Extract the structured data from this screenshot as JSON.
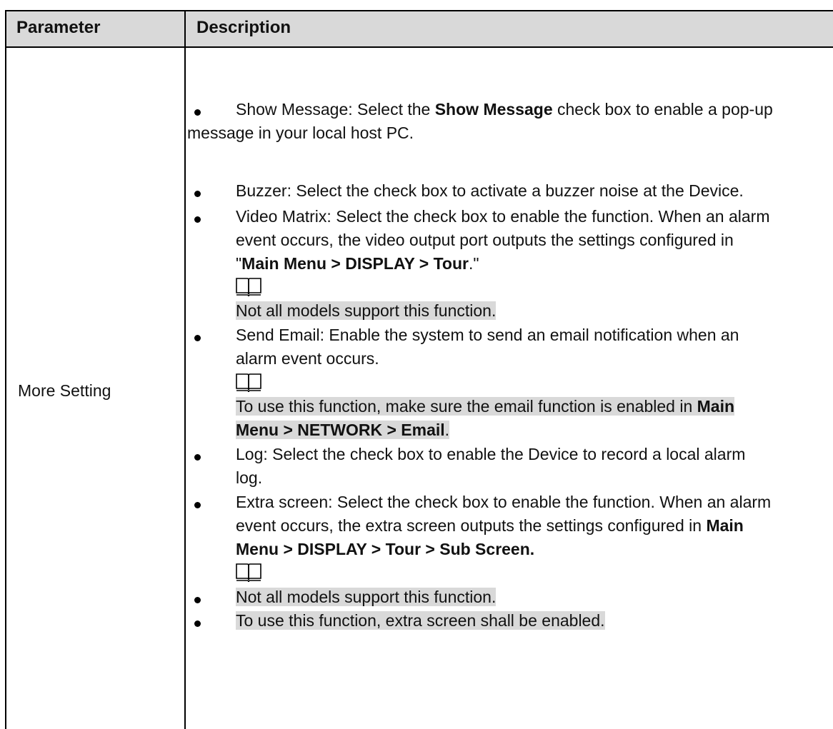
{
  "table": {
    "header": {
      "parameter": "Parameter",
      "description": "Description"
    },
    "row": {
      "parameter": "More Setting",
      "show_message": {
        "prefix": "Show Message: Select the ",
        "bold": "Show Message",
        "line1_suffix": " check box to enable a pop-up",
        "line2": "message in your local host PC."
      },
      "buzzer": "Buzzer: Select the check box to activate a buzzer noise at the Device.",
      "video_matrix": {
        "line1": "Video Matrix: Select the check box to enable the function. When an alarm",
        "line2": "event occurs, the video output port outputs the settings configured in",
        "quote_open": "\"",
        "bold": "Main Menu > DISPLAY > Tour",
        "tail": ".\"",
        "note": "Not all models support this function."
      },
      "send_email": {
        "line1": "Send Email: Enable the system to send an email notification when an",
        "line2": "alarm event occurs.",
        "note_line1_text": "To use this function, make sure the email function is enabled in ",
        "note_line1_bold": "Main",
        "note_line2_bold": "Menu > NETWORK > Email",
        "note_line2_tail": "."
      },
      "log": {
        "line1": "Log: Select the check box to enable the Device to record a local alarm",
        "line2": "log."
      },
      "extra_screen": {
        "line1": "Extra screen: Select the check box to enable the function. When an alarm",
        "line2_text": "event occurs, the extra screen outputs the settings configured in ",
        "line2_bold": "Main",
        "line3_bold": "Menu > DISPLAY > Tour > Sub Screen."
      },
      "notes": [
        "Not all models support this function.",
        "To use this function, extra screen shall be enabled."
      ]
    }
  },
  "icons": {
    "note": "note-book-icon"
  }
}
